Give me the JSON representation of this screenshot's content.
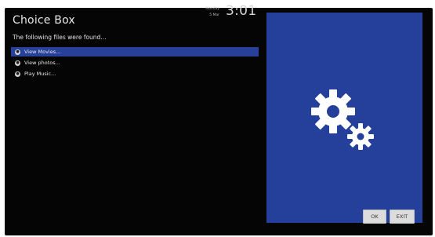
{
  "dialog": {
    "title": "Choice Box",
    "subtitle": "The following files were found..."
  },
  "clock": {
    "day": "Monday",
    "date": "5 Mar",
    "time": "3:01"
  },
  "options": [
    {
      "label": "View Movies...",
      "selected": true
    },
    {
      "label": "View photos...",
      "selected": false
    },
    {
      "label": "Play Music...",
      "selected": false
    }
  ],
  "panel": {
    "icon": "gears-icon",
    "background": "#25409a"
  },
  "buttons": {
    "ok_label": "OK",
    "exit_label": "EXIT"
  },
  "colors": {
    "accent": "#27409a",
    "screen_bg": "#050505"
  }
}
